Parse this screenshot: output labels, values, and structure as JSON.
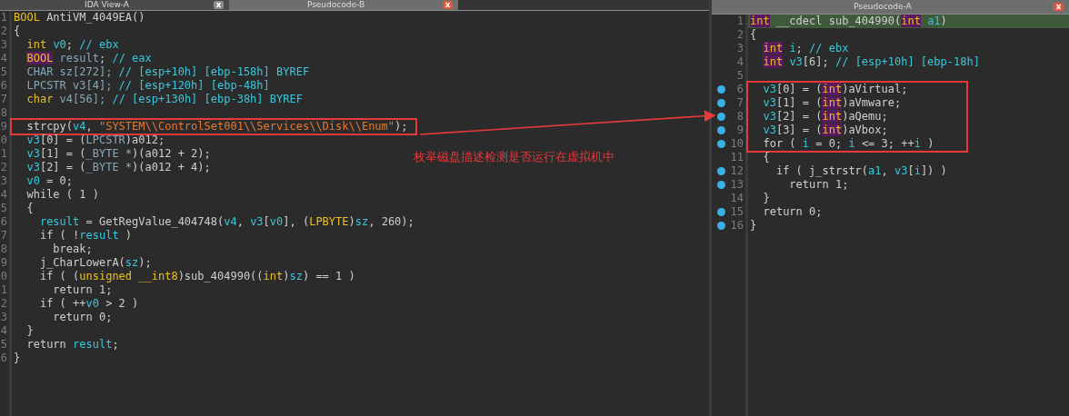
{
  "left_panel": {
    "tabs": [
      {
        "label": "IDA View-A",
        "selected": false
      },
      {
        "label": "Pseudocode-B",
        "selected": true
      }
    ],
    "lines": [
      {
        "number": "1",
        "tokens": [
          {
            "kind": "type",
            "text": "BOOL"
          },
          {
            "kind": "plain",
            "text": " AntiVM_4049EA()"
          }
        ]
      },
      {
        "number": "2",
        "tokens": [
          {
            "kind": "plain",
            "text": "{"
          }
        ]
      },
      {
        "number": "3",
        "tokens": [
          {
            "kind": "type",
            "text": "  int"
          },
          {
            "kind": "var",
            "text": " v0"
          },
          {
            "kind": "plain",
            "text": "; "
          },
          {
            "kind": "comment",
            "text": "// ebx"
          }
        ]
      },
      {
        "number": "4",
        "tokens": [
          {
            "kind": "type_hl",
            "text": "  BOOL"
          },
          {
            "kind": "name",
            "text": " result"
          },
          {
            "kind": "plain",
            "text": "; "
          },
          {
            "kind": "comment",
            "text": "// eax"
          }
        ]
      },
      {
        "number": "5",
        "tokens": [
          {
            "kind": "name",
            "text": "  CHAR sz[272];"
          },
          {
            "kind": "comment",
            "text": " // [esp+10h] [ebp-158h] BYREF"
          }
        ]
      },
      {
        "number": "6",
        "tokens": [
          {
            "kind": "name",
            "text": "  LPCSTR v3[4];"
          },
          {
            "kind": "comment",
            "text": " // [esp+120h] [ebp-48h]"
          }
        ]
      },
      {
        "number": "7",
        "tokens": [
          {
            "kind": "type",
            "text": "  char"
          },
          {
            "kind": "name",
            "text": " v4[56];"
          },
          {
            "kind": "comment",
            "text": " // [esp+130h] [ebp-38h] BYREF"
          }
        ]
      },
      {
        "number": "8"
      },
      {
        "number": "9",
        "framed": true,
        "tokens": [
          {
            "kind": "plain",
            "text": "  strcpy("
          },
          {
            "kind": "var",
            "text": "v4"
          },
          {
            "kind": "plain",
            "text": ", "
          },
          {
            "kind": "string",
            "text": "\"SYSTEM\\\\ControlSet001\\\\Services\\\\Disk\\\\Enum\""
          },
          {
            "kind": "plain",
            "text": ");"
          }
        ]
      },
      {
        "number": "0",
        "tokens": [
          {
            "kind": "var",
            "text": "  v3"
          },
          {
            "kind": "plain",
            "text": "[0] = ("
          },
          {
            "kind": "name",
            "text": "LPCSTR"
          },
          {
            "kind": "plain",
            "text": ")a012;"
          }
        ]
      },
      {
        "number": "1",
        "tokens": [
          {
            "kind": "var",
            "text": "  v3"
          },
          {
            "kind": "plain",
            "text": "[1] = ("
          },
          {
            "kind": "name",
            "text": "_BYTE *"
          },
          {
            "kind": "plain",
            "text": ")(a012 + 2);"
          }
        ]
      },
      {
        "number": "2",
        "tokens": [
          {
            "kind": "var",
            "text": "  v3"
          },
          {
            "kind": "plain",
            "text": "[2] = ("
          },
          {
            "kind": "name",
            "text": "_BYTE *"
          },
          {
            "kind": "plain",
            "text": ")(a012 + 4);"
          }
        ]
      },
      {
        "number": "3",
        "tokens": [
          {
            "kind": "var",
            "text": "  v0"
          },
          {
            "kind": "plain",
            "text": " = 0;"
          }
        ]
      },
      {
        "number": "4",
        "tokens": [
          {
            "kind": "plain",
            "text": "  while ( 1 )"
          }
        ]
      },
      {
        "number": "5",
        "tokens": [
          {
            "kind": "plain",
            "text": "  {"
          }
        ]
      },
      {
        "number": "6",
        "tokens": [
          {
            "kind": "var",
            "text": "    result"
          },
          {
            "kind": "plain",
            "text": " = GetRegValue_404748("
          },
          {
            "kind": "var",
            "text": "v4"
          },
          {
            "kind": "plain",
            "text": ", "
          },
          {
            "kind": "var",
            "text": "v3"
          },
          {
            "kind": "plain",
            "text": "["
          },
          {
            "kind": "var",
            "text": "v0"
          },
          {
            "kind": "plain",
            "text": "], ("
          },
          {
            "kind": "type",
            "text": "LPBYTE"
          },
          {
            "kind": "plain",
            "text": ")"
          },
          {
            "kind": "var",
            "text": "sz"
          },
          {
            "kind": "plain",
            "text": ", 260);"
          }
        ]
      },
      {
        "number": "7",
        "tokens": [
          {
            "kind": "plain",
            "text": "    if ( !"
          },
          {
            "kind": "var",
            "text": "result"
          },
          {
            "kind": "plain",
            "text": " )"
          }
        ]
      },
      {
        "number": "8",
        "tokens": [
          {
            "kind": "plain",
            "text": "      break;"
          }
        ]
      },
      {
        "number": "9",
        "tokens": [
          {
            "kind": "plain",
            "text": "    j_CharLowerA("
          },
          {
            "kind": "var",
            "text": "sz"
          },
          {
            "kind": "plain",
            "text": ");"
          }
        ]
      },
      {
        "number": "0",
        "tokens": [
          {
            "kind": "plain",
            "text": "    if ( ("
          },
          {
            "kind": "type",
            "text": "unsigned __int8"
          },
          {
            "kind": "plain",
            "text": ")sub_404990(("
          },
          {
            "kind": "type",
            "text": "int"
          },
          {
            "kind": "plain",
            "text": ")"
          },
          {
            "kind": "var",
            "text": "sz"
          },
          {
            "kind": "plain",
            "text": ") == 1 )"
          }
        ]
      },
      {
        "number": "1",
        "tokens": [
          {
            "kind": "plain",
            "text": "      return 1;"
          }
        ]
      },
      {
        "number": "2",
        "tokens": [
          {
            "kind": "plain",
            "text": "    if ( ++"
          },
          {
            "kind": "var",
            "text": "v0"
          },
          {
            "kind": "plain",
            "text": " > 2 )"
          }
        ]
      },
      {
        "number": "3",
        "tokens": [
          {
            "kind": "plain",
            "text": "      return 0;"
          }
        ]
      },
      {
        "number": "4",
        "tokens": [
          {
            "kind": "plain",
            "text": "  }"
          }
        ]
      },
      {
        "number": "5",
        "tokens": [
          {
            "kind": "plain",
            "text": "  return "
          },
          {
            "kind": "var",
            "text": "result"
          },
          {
            "kind": "plain",
            "text": ";"
          }
        ]
      },
      {
        "number": "6",
        "tokens": [
          {
            "kind": "plain",
            "text": "}"
          }
        ]
      }
    ]
  },
  "right_panel": {
    "tabs": [
      {
        "label": "Pseudocode-A",
        "selected": true
      }
    ],
    "lines": [
      {
        "number": "1",
        "breakpoint": false,
        "current": true,
        "tokens": [
          {
            "kind": "type_hl",
            "text": "int"
          },
          {
            "kind": "plain",
            "text": " __cdecl sub_404990("
          },
          {
            "kind": "type_hl",
            "text": "int"
          },
          {
            "kind": "var",
            "text": " a1"
          },
          {
            "kind": "plain",
            "text": ")"
          }
        ]
      },
      {
        "number": "2",
        "breakpoint": false,
        "current": false,
        "tokens": [
          {
            "kind": "plain",
            "text": "{"
          }
        ]
      },
      {
        "number": "3",
        "breakpoint": false,
        "current": false,
        "tokens": [
          {
            "kind": "type_hl",
            "text": "  int"
          },
          {
            "kind": "var",
            "text": " i"
          },
          {
            "kind": "plain",
            "text": "; "
          },
          {
            "kind": "comment",
            "text": "// ebx"
          }
        ]
      },
      {
        "number": "4",
        "breakpoint": false,
        "current": false,
        "tokens": [
          {
            "kind": "type_hl",
            "text": "  int"
          },
          {
            "kind": "var",
            "text": " v3"
          },
          {
            "kind": "plain",
            "text": "[6]; "
          },
          {
            "kind": "comment",
            "text": "// [esp+10h] [ebp-18h]"
          }
        ]
      },
      {
        "number": "5",
        "breakpoint": false,
        "current": false
      },
      {
        "number": "6",
        "framed": true,
        "breakpoint": true,
        "current": false,
        "tokens": [
          {
            "kind": "var",
            "text": "  v3"
          },
          {
            "kind": "plain",
            "text": "[0] = ("
          },
          {
            "kind": "type_hl",
            "text": "int"
          },
          {
            "kind": "plain",
            "text": ")aVirtual;"
          }
        ]
      },
      {
        "number": "7",
        "framed": true,
        "breakpoint": true,
        "current": false,
        "tokens": [
          {
            "kind": "var",
            "text": "  v3"
          },
          {
            "kind": "plain",
            "text": "[1] = ("
          },
          {
            "kind": "type_hl",
            "text": "int"
          },
          {
            "kind": "plain",
            "text": ")aVmware;"
          }
        ]
      },
      {
        "number": "8",
        "framed": true,
        "breakpoint": true,
        "current": false,
        "tokens": [
          {
            "kind": "var",
            "text": "  v3"
          },
          {
            "kind": "plain",
            "text": "[2] = ("
          },
          {
            "kind": "type_hl",
            "text": "int"
          },
          {
            "kind": "plain",
            "text": ")aQemu;"
          }
        ]
      },
      {
        "number": "9",
        "framed": true,
        "breakpoint": true,
        "current": false,
        "tokens": [
          {
            "kind": "var",
            "text": "  v3"
          },
          {
            "kind": "plain",
            "text": "[3] = ("
          },
          {
            "kind": "type_hl",
            "text": "int"
          },
          {
            "kind": "plain",
            "text": ")aVbox;"
          }
        ]
      },
      {
        "number": "10",
        "framed": true,
        "breakpoint": true,
        "current": false,
        "tokens": [
          {
            "kind": "plain",
            "text": "  for ( "
          },
          {
            "kind": "var",
            "text": "i"
          },
          {
            "kind": "plain",
            "text": " = 0; "
          },
          {
            "kind": "var",
            "text": "i"
          },
          {
            "kind": "plain",
            "text": " <= 3; ++"
          },
          {
            "kind": "var",
            "text": "i"
          },
          {
            "kind": "plain",
            "text": " )"
          }
        ]
      },
      {
        "number": "11",
        "breakpoint": false,
        "current": false,
        "tokens": [
          {
            "kind": "plain",
            "text": "  {"
          }
        ]
      },
      {
        "number": "12",
        "breakpoint": true,
        "current": false,
        "tokens": [
          {
            "kind": "plain",
            "text": "    if ( j_strstr("
          },
          {
            "kind": "var",
            "text": "a1"
          },
          {
            "kind": "plain",
            "text": ", "
          },
          {
            "kind": "var",
            "text": "v3"
          },
          {
            "kind": "plain",
            "text": "["
          },
          {
            "kind": "var",
            "text": "i"
          },
          {
            "kind": "plain",
            "text": "]) )"
          }
        ]
      },
      {
        "number": "13",
        "breakpoint": true,
        "current": false,
        "tokens": [
          {
            "kind": "plain",
            "text": "      return 1;"
          }
        ]
      },
      {
        "number": "14",
        "breakpoint": false,
        "current": false,
        "tokens": [
          {
            "kind": "plain",
            "text": "  }"
          }
        ]
      },
      {
        "number": "15",
        "breakpoint": true,
        "current": false,
        "tokens": [
          {
            "kind": "plain",
            "text": "  return 0;"
          }
        ]
      },
      {
        "number": "16",
        "breakpoint": true,
        "current": false,
        "tokens": [
          {
            "kind": "plain",
            "text": "}"
          }
        ]
      }
    ]
  },
  "annotation": {
    "text": "枚举磁盘描述检测是否运行在虚拟机中"
  }
}
